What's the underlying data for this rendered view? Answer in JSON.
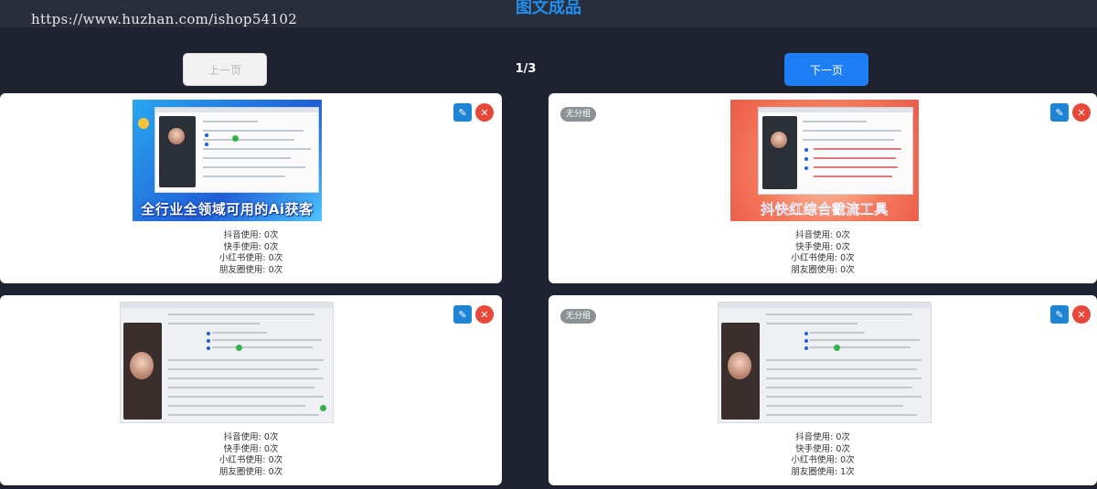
{
  "watermark": "https://www.huzhan.com/ishop54102",
  "page_title": "图文成品",
  "nav": {
    "prev_label": "上一页",
    "next_label": "下一页",
    "pager_text": "1/3"
  },
  "icons": {
    "edit": "pencil-icon",
    "delete": "close-icon"
  },
  "colors": {
    "accent": "#1e7ef5",
    "delete": "#e8473a",
    "edit": "#1e84d6",
    "badge": "#8a9296"
  },
  "cards": [
    {
      "badge": "",
      "image_caption": "全行业全领域可用的Ai获客",
      "stats": [
        "抖音使用: 0次",
        "快手使用: 0次",
        "小红书使用: 0次",
        "朋友圈使用: 0次"
      ]
    },
    {
      "badge": "无分组",
      "image_caption": "抖快红综合截流工具",
      "stats": [
        "抖音使用: 0次",
        "快手使用: 0次",
        "小红书使用: 0次",
        "朋友圈使用: 0次"
      ]
    },
    {
      "badge": "",
      "image_caption": "",
      "stats": [
        "抖音使用: 0次",
        "快手使用: 0次",
        "小红书使用: 0次",
        "朋友圈使用: 0次"
      ]
    },
    {
      "badge": "无分组",
      "image_caption": "",
      "stats": [
        "抖音使用: 0次",
        "快手使用: 0次",
        "小红书使用: 0次",
        "朋友圈使用: 1次"
      ]
    }
  ]
}
